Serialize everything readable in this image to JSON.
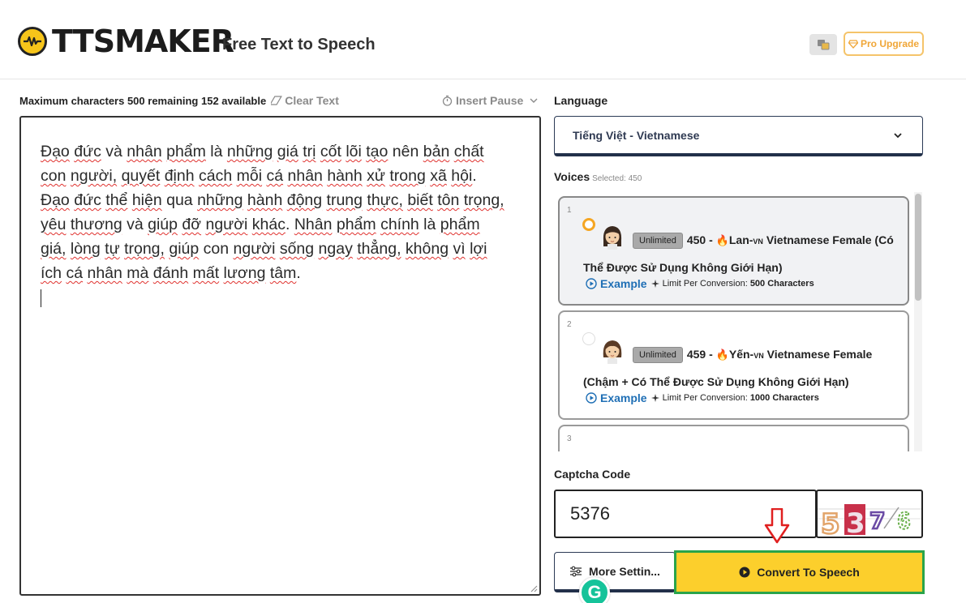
{
  "header": {
    "logo_text": "TTSMAKER",
    "tagline": "Free Text to Speech",
    "pro_label": "Pro Upgrade"
  },
  "editor": {
    "char_info": "Maximum characters 500 remaining 152 available",
    "clear_label": "Clear Text",
    "insert_pause_label": "Insert Pause",
    "lines": [
      [
        "Đạo",
        " ",
        "đức",
        " và ",
        "nhân",
        " ",
        "phẩm",
        " là ",
        "những",
        " ",
        "giá",
        " ",
        "trị",
        " ",
        "cốt",
        " ",
        "lõi",
        " ",
        "tạo",
        " nên ",
        "bản",
        " ",
        "chất"
      ],
      [
        "con",
        " ",
        "người,",
        " ",
        "quyết",
        " ",
        "định",
        " ",
        "cách",
        " ",
        "mỗi",
        " ",
        "cá",
        " ",
        "nhân",
        " ",
        "hành",
        " ",
        "xử",
        " ",
        "trong",
        " ",
        "xã",
        " ",
        "hội",
        "."
      ],
      [
        "Đạo",
        " ",
        "đức",
        " ",
        "thể",
        " ",
        "hiện",
        " qua ",
        "những",
        " ",
        "hành",
        " ",
        "động",
        " ",
        "trung",
        " ",
        "thực,",
        " ",
        "biết",
        " ",
        "tôn",
        " ",
        "trọng,"
      ],
      [
        "yêu",
        " ",
        "thương",
        " và ",
        "giúp",
        " ",
        "đỡ",
        " ",
        "người",
        " ",
        "khác",
        ". ",
        "Nhân",
        " ",
        "phẩm",
        " ",
        "chính",
        " là ",
        "phẩm"
      ],
      [
        "giá,",
        " ",
        "lòng",
        " ",
        "tự",
        " ",
        "trọng,",
        " ",
        "giúp",
        " con ",
        "người",
        " ",
        "sống",
        " ",
        "ngay",
        " ",
        "thẳng,",
        " ",
        "không",
        " ",
        "vì",
        " ",
        "lợi"
      ],
      [
        "ích",
        " ",
        "cá",
        " ",
        "nhân",
        " ",
        "mà",
        " ",
        "đánh",
        " ",
        "mất",
        " ",
        "lương",
        " ",
        "tâm",
        "."
      ]
    ]
  },
  "language": {
    "label": "Language",
    "selected": "Tiếng Việt - Vietnamese"
  },
  "voices": {
    "label": "Voices",
    "selected_text": "Selected: 450",
    "items": [
      {
        "num": "1",
        "badge": "Unlimited",
        "id_name": "450 - ",
        "fire": "🔥",
        "name": "Lan-",
        "vn": "VN",
        "desc_line1": " Vietnamese Female (Có",
        "desc_line2": "Thể Được Sử Dụng Không Giới Hạn)",
        "example": "Example",
        "limit_prefix": "Limit Per Conversion: ",
        "limit_value": "500 Characters"
      },
      {
        "num": "2",
        "badge": "Unlimited",
        "id_name": "459 - ",
        "fire": "🔥",
        "name": "Yến-",
        "vn": "VN",
        "desc_line1": " Vietnamese Female",
        "desc_line2": "(Chậm + Có Thể Được Sử Dụng Không Giới Hạn)",
        "example": "Example",
        "limit_prefix": "Limit Per Conversion: ",
        "limit_value": "1000 Characters"
      },
      {
        "num": "3"
      }
    ]
  },
  "captcha": {
    "label": "Captcha Code",
    "value": "5376",
    "image_digits": [
      "5",
      "3",
      "7",
      "6"
    ]
  },
  "actions": {
    "more_settings": "More Settin...",
    "convert": "Convert To Speech"
  },
  "colors": {
    "accent_yellow": "#fccf2c",
    "highlight_green": "#2aa44a",
    "link_blue": "#1f6fb5",
    "pro_orange": "#f0a637"
  }
}
